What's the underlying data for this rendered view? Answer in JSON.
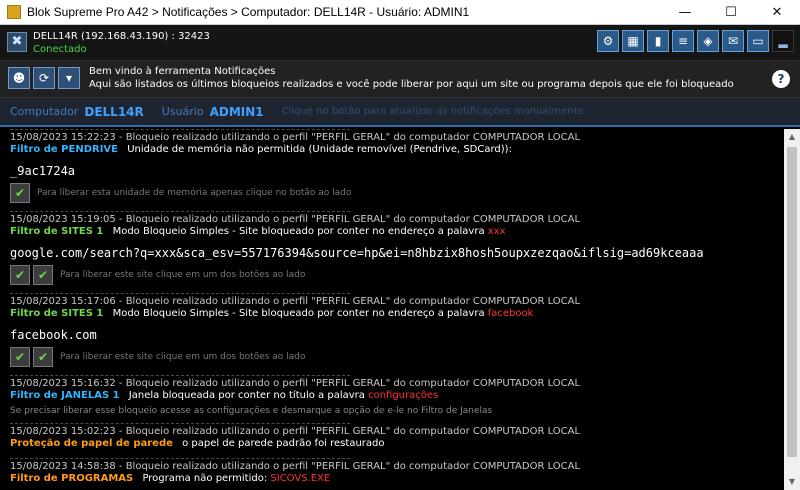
{
  "window": {
    "title": "Blok Supreme Pro A42 > Notificações > Computador: DELL14R - Usuário: ADMIN1",
    "minimize": "—",
    "maximize": "☐",
    "close": "✕"
  },
  "connection": {
    "host": "DELL14R (192.168.43.190) : 32423",
    "status": "Conectado",
    "icon": "network-icon"
  },
  "toolbar": {
    "buttons": [
      "settings-icon",
      "grid-icon",
      "chart-icon",
      "list-icon",
      "record-icon",
      "messages-icon",
      "monitor-icon",
      "signal-icon"
    ]
  },
  "info": {
    "title": "Bem vindo à ferramenta Notificações",
    "subtitle": "Aqui são listados os últimos bloqueios realizados e você pode liberar por aqui um site ou programa depois que ele foi bloqueado",
    "help": "?"
  },
  "computer": {
    "label": "Computador",
    "value": "DELL14R",
    "user_label": "Usuário",
    "user_value": "ADMIN1",
    "hint": "Clique no botão para atualizar as notificações manualmente"
  },
  "entries": [
    {
      "timestamp": "15/08/2023 15:22:23 - Bloqueio realizado utilizando o perfil \"PERFIL GERAL\" do computador COMPUTADOR LOCAL",
      "filter": "Filtro de PENDRIVE",
      "filter_color": "blue",
      "description": "Unidade de memória não permitida (Unidade removível (Pendrive, SDCard)):",
      "keyword": "",
      "value": "_9ac1724a",
      "action_hint": "Para liberar esta unidade de memória apenas clique no botão ao lado",
      "buttons": 1
    },
    {
      "timestamp": "15/08/2023 15:19:05 - Bloqueio realizado utilizando o perfil \"PERFIL GERAL\" do computador COMPUTADOR LOCAL",
      "filter": "Filtro de SITES 1",
      "filter_color": "green",
      "description": "Modo Bloqueio Simples  -  Site bloqueado por conter no endereço a palavra",
      "keyword": "xxx",
      "value": "google.com/search?q=xxx&sca_esv=557176394&source=hp&ei=n8hbzix8hosh5oupxzezqao&iflsig=ad69kceaaa",
      "action_hint": "Para liberar este site clique em um dos botões ao lado",
      "buttons": 2
    },
    {
      "timestamp": "15/08/2023 15:17:06 - Bloqueio realizado utilizando o perfil \"PERFIL GERAL\" do computador COMPUTADOR LOCAL",
      "filter": "Filtro de SITES 1",
      "filter_color": "green",
      "description": "Modo Bloqueio Simples  -  Site bloqueado por conter no endereço a palavra",
      "keyword": "facebook",
      "value": "facebook.com",
      "action_hint": "Para liberar este site clique em um dos botões ao lado",
      "buttons": 2
    },
    {
      "timestamp": "15/08/2023 15:16:32 - Bloqueio realizado utilizando o perfil \"PERFIL GERAL\" do computador COMPUTADOR LOCAL",
      "filter": "Filtro de JANELAS 1",
      "filter_color": "blue",
      "description": "Janela bloqueada por conter no título a palavra",
      "keyword": "configurações",
      "note": "Se precisar liberar esse bloqueio acesse as configurações e desmarque a opção de e-le no Filtro de Janelas"
    },
    {
      "timestamp": "15/08/2023 15:02:23 - Bloqueio realizado utilizando o perfil \"PERFIL GERAL\" do computador COMPUTADOR LOCAL",
      "filter": "Proteção de papel de parede",
      "filter_color": "orange",
      "description": "o papel de parede padrão foi restaurado",
      "keyword": ""
    },
    {
      "timestamp": "15/08/2023 14:58:38 - Bloqueio realizado utilizando o perfil \"PERFIL GERAL\" do computador COMPUTADOR LOCAL",
      "filter": "Filtro de PROGRAMAS",
      "filter_color": "orange",
      "description": "Programa não permitido:",
      "keyword": "SICOVS.EXE"
    }
  ],
  "icons": {
    "allow": "✔",
    "allow_all": "✔"
  }
}
